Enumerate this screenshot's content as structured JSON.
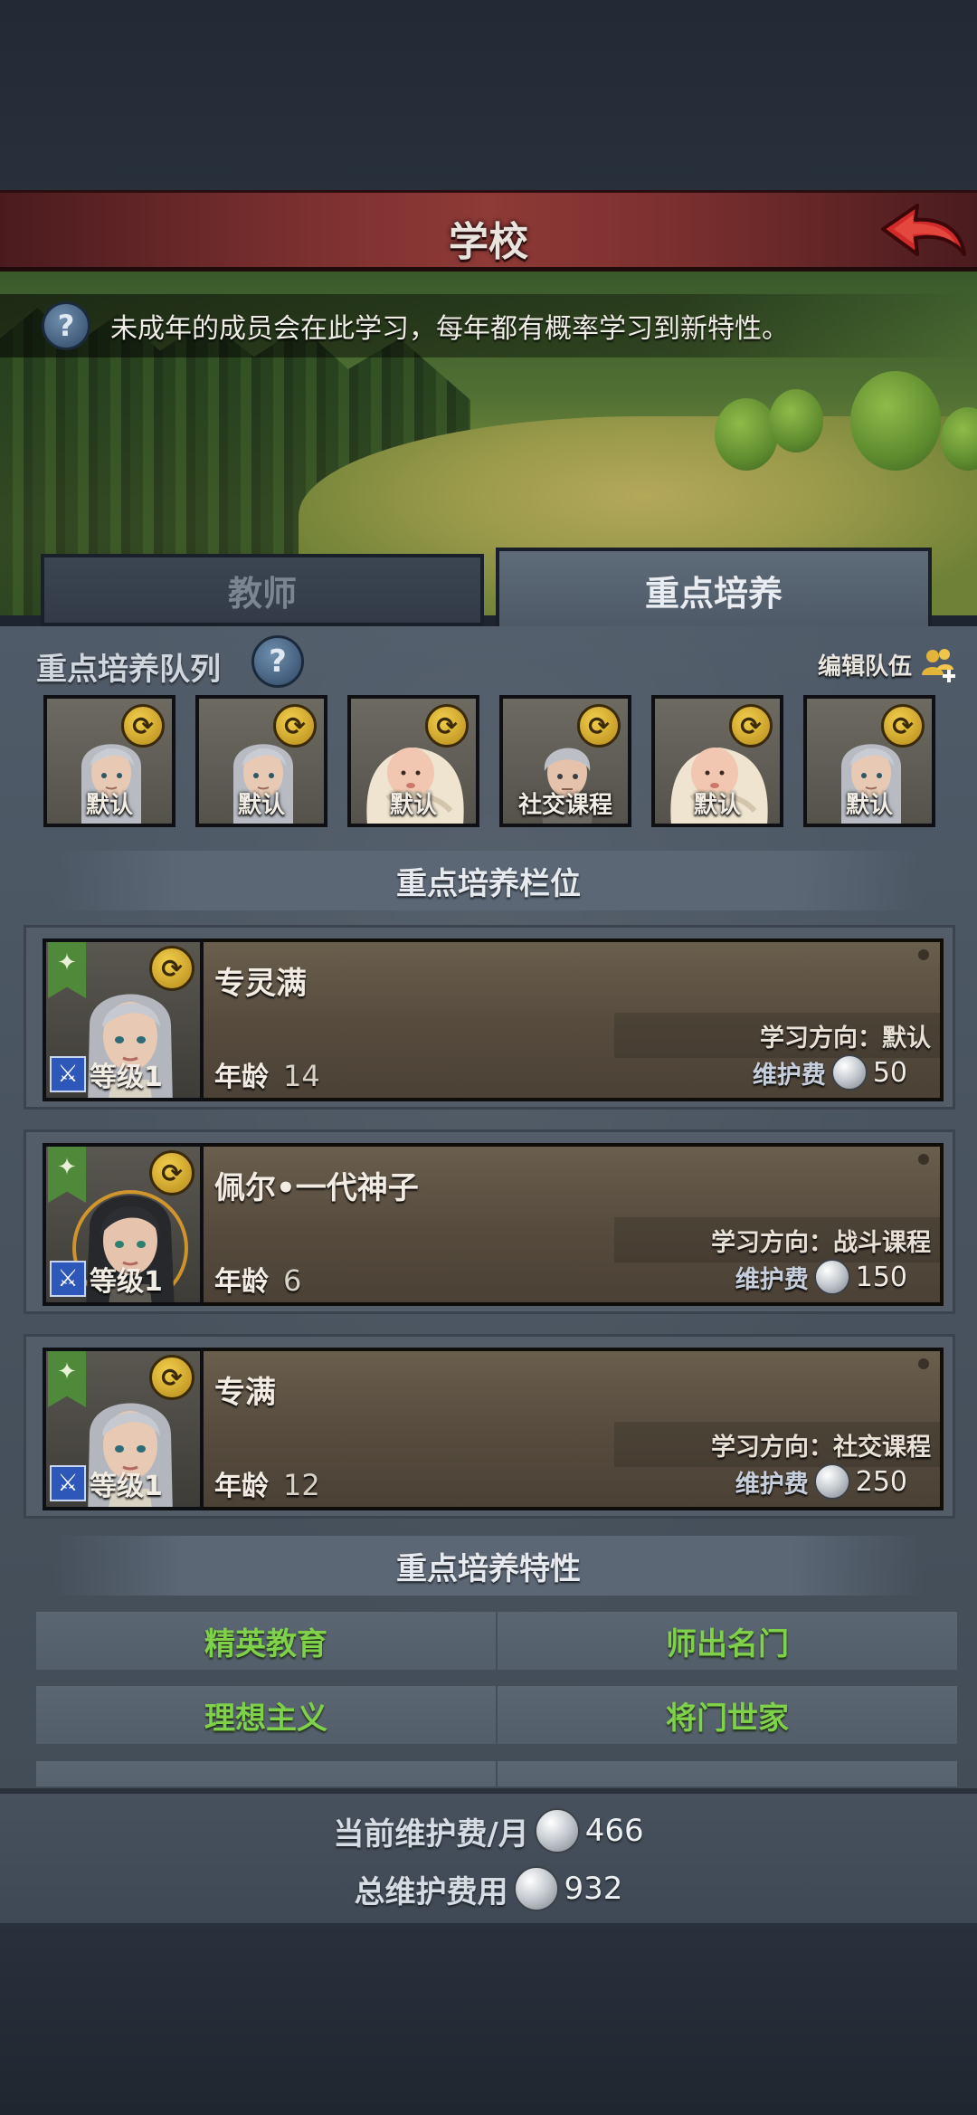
{
  "header": {
    "title": "学校",
    "info_text": "未成年的成员会在此学习，每年都有概率学习到新特性。"
  },
  "tabs": [
    {
      "label": "教师",
      "active": false
    },
    {
      "label": "重点培养",
      "active": true
    }
  ],
  "queue": {
    "title": "重点培养队列",
    "edit_label": "编辑队伍",
    "slots": [
      {
        "label": "默认",
        "portrait": "girl-silver-hair"
      },
      {
        "label": "默认",
        "portrait": "girl-silver-hair"
      },
      {
        "label": "默认",
        "portrait": "swaddled-baby"
      },
      {
        "label": "社交课程",
        "portrait": "boy-silver-hair"
      },
      {
        "label": "默认",
        "portrait": "swaddled-baby"
      },
      {
        "label": "默认",
        "portrait": "girl-silver-hair"
      }
    ]
  },
  "slots_section": {
    "title": "重点培养栏位",
    "students": [
      {
        "name": "专灵满",
        "level_text": "等级1",
        "age_label": "年龄",
        "age": "14",
        "direction": "学习方向：默认",
        "fee_label": "维护费",
        "fee": "50",
        "portrait": "girl-silver-hair"
      },
      {
        "name": "佩尔•一代神子",
        "level_text": "等级1",
        "age_label": "年龄",
        "age": "6",
        "direction": "学习方向：战斗课程",
        "fee_label": "维护费",
        "fee": "150",
        "portrait": "girl-dark-hair-glow"
      },
      {
        "name": "专满",
        "level_text": "等级1",
        "age_label": "年龄",
        "age": "12",
        "direction": "学习方向：社交课程",
        "fee_label": "维护费",
        "fee": "250",
        "portrait": "girl-silver-hair"
      }
    ]
  },
  "traits_section": {
    "title": "重点培养特性",
    "traits": [
      "精英教育",
      "师出名门",
      "理想主义",
      "将门世家"
    ]
  },
  "footer": {
    "monthly_label": "当前维护费/月",
    "monthly_value": "466",
    "total_label": "总维护费用",
    "total_value": "932"
  },
  "colors": {
    "trait_text": "#7fd14a",
    "title_bar": "#7a2f2f",
    "accent_gold": "#e3b43a"
  }
}
